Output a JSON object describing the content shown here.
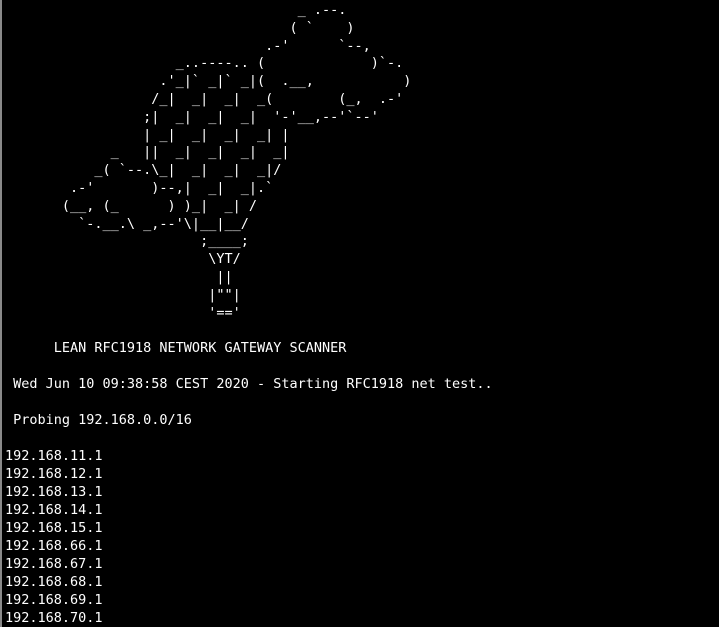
{
  "terminal": {
    "background": "#000000",
    "foreground": "#ffffff",
    "ascii_art": "                                    _ .--.\n                                   ( `    )\n                                .-'      `--,\n                     _..----.. (             )`-.\n                   .'_|` _|` _|(  .__,           )\n                  /_|  _|  _|  _(        (_,  .-'\n                 ;|  _|  _|  _|  '-'__,--'`--'\n                 | _|  _|  _|  _| |\n             _   ||  _|  _|  _|  _|\n           _( `--.\\_|  _|  _|  _|/\n        .-'       )--,|  _|  _|.`\n       (__, (_      ) )_|  _| /\n         `-.__.\\ _,--'\\|__|__/\n                        ;____;\n                         \\YT/\n                          ||\n                         |\"\"|\n                         '=='",
    "title_line": "      LEAN RFC1918 NETWORK GATEWAY SCANNER",
    "start_line": " Wed Jun 10 09:38:58 CEST 2020 - Starting RFC1918 net test..",
    "probe_line": " Probing 192.168.0.0/16",
    "results": [
      "192.168.11.1",
      "192.168.12.1",
      "192.168.13.1",
      "192.168.14.1",
      "192.168.15.1",
      "192.168.66.1",
      "192.168.67.1",
      "192.168.68.1",
      "192.168.69.1",
      "192.168.70.1"
    ]
  }
}
